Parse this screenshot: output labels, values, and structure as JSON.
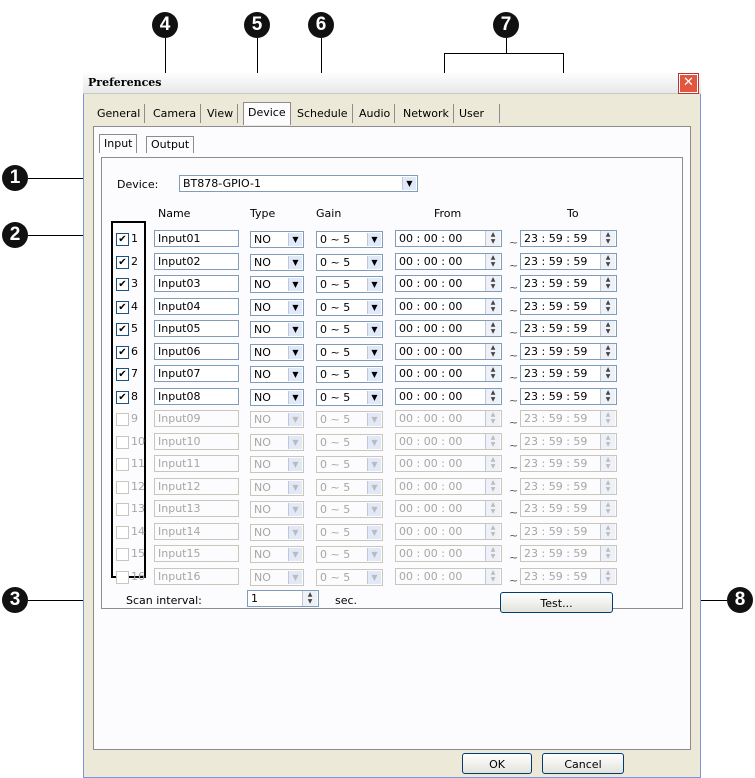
{
  "callouts": [
    "4",
    "5",
    "6",
    "7",
    "1",
    "2",
    "3",
    "8"
  ],
  "window": {
    "title": "Preferences",
    "close_glyph": "✕"
  },
  "tabs": [
    "General",
    "Camera",
    "View",
    "Device",
    "Schedule",
    "Audio",
    "Network",
    "User"
  ],
  "active_tab": "Device",
  "subtabs": [
    "Input",
    "Output"
  ],
  "device": {
    "label": "Device:",
    "value": "BT878-GPIO-1"
  },
  "headers": {
    "name": "Name",
    "type": "Type",
    "gain": "Gain",
    "from": "From",
    "to": "To"
  },
  "tilde": "~",
  "rows": [
    {
      "num": "1",
      "checked": true,
      "enabled": true,
      "name": "Input01",
      "type": "NO",
      "gain": "0 ~ 5",
      "from": "00 : 00 : 00",
      "to": "23 : 59 : 59"
    },
    {
      "num": "2",
      "checked": true,
      "enabled": true,
      "name": "Input02",
      "type": "NO",
      "gain": "0 ~ 5",
      "from": "00 : 00 : 00",
      "to": "23 : 59 : 59"
    },
    {
      "num": "3",
      "checked": true,
      "enabled": true,
      "name": "Input03",
      "type": "NO",
      "gain": "0 ~ 5",
      "from": "00 : 00 : 00",
      "to": "23 : 59 : 59"
    },
    {
      "num": "4",
      "checked": true,
      "enabled": true,
      "name": "Input04",
      "type": "NO",
      "gain": "0 ~ 5",
      "from": "00 : 00 : 00",
      "to": "23 : 59 : 59"
    },
    {
      "num": "5",
      "checked": true,
      "enabled": true,
      "name": "Input05",
      "type": "NO",
      "gain": "0 ~ 5",
      "from": "00 : 00 : 00",
      "to": "23 : 59 : 59"
    },
    {
      "num": "6",
      "checked": true,
      "enabled": true,
      "name": "Input06",
      "type": "NO",
      "gain": "0 ~ 5",
      "from": "00 : 00 : 00",
      "to": "23 : 59 : 59"
    },
    {
      "num": "7",
      "checked": true,
      "enabled": true,
      "name": "Input07",
      "type": "NO",
      "gain": "0 ~ 5",
      "from": "00 : 00 : 00",
      "to": "23 : 59 : 59"
    },
    {
      "num": "8",
      "checked": true,
      "enabled": true,
      "name": "Input08",
      "type": "NO",
      "gain": "0 ~ 5",
      "from": "00 : 00 : 00",
      "to": "23 : 59 : 59"
    },
    {
      "num": "9",
      "checked": false,
      "enabled": false,
      "name": "Input09",
      "type": "NO",
      "gain": "0 ~ 5",
      "from": "00 : 00 : 00",
      "to": "23 : 59 : 59"
    },
    {
      "num": "10",
      "checked": false,
      "enabled": false,
      "name": "Input10",
      "type": "NO",
      "gain": "0 ~ 5",
      "from": "00 : 00 : 00",
      "to": "23 : 59 : 59"
    },
    {
      "num": "11",
      "checked": false,
      "enabled": false,
      "name": "Input11",
      "type": "NO",
      "gain": "0 ~ 5",
      "from": "00 : 00 : 00",
      "to": "23 : 59 : 59"
    },
    {
      "num": "12",
      "checked": false,
      "enabled": false,
      "name": "Input12",
      "type": "NO",
      "gain": "0 ~ 5",
      "from": "00 : 00 : 00",
      "to": "23 : 59 : 59"
    },
    {
      "num": "13",
      "checked": false,
      "enabled": false,
      "name": "Input13",
      "type": "NO",
      "gain": "0 ~ 5",
      "from": "00 : 00 : 00",
      "to": "23 : 59 : 59"
    },
    {
      "num": "14",
      "checked": false,
      "enabled": false,
      "name": "Input14",
      "type": "NO",
      "gain": "0 ~ 5",
      "from": "00 : 00 : 00",
      "to": "23 : 59 : 59"
    },
    {
      "num": "15",
      "checked": false,
      "enabled": false,
      "name": "Input15",
      "type": "NO",
      "gain": "0 ~ 5",
      "from": "00 : 00 : 00",
      "to": "23 : 59 : 59"
    },
    {
      "num": "16",
      "checked": false,
      "enabled": false,
      "name": "Input16",
      "type": "NO",
      "gain": "0 ~ 5",
      "from": "00 : 00 : 00",
      "to": "23 : 59 : 59"
    }
  ],
  "scan": {
    "label": "Scan interval:",
    "value": "1",
    "unit": "sec."
  },
  "buttons": {
    "test": "Test...",
    "ok": "OK",
    "cancel": "Cancel"
  },
  "icons": {
    "dropdown": "chevron-down-icon",
    "spinner": "spinner-arrows-icon",
    "check": "checkmark-icon",
    "close": "close-icon"
  }
}
